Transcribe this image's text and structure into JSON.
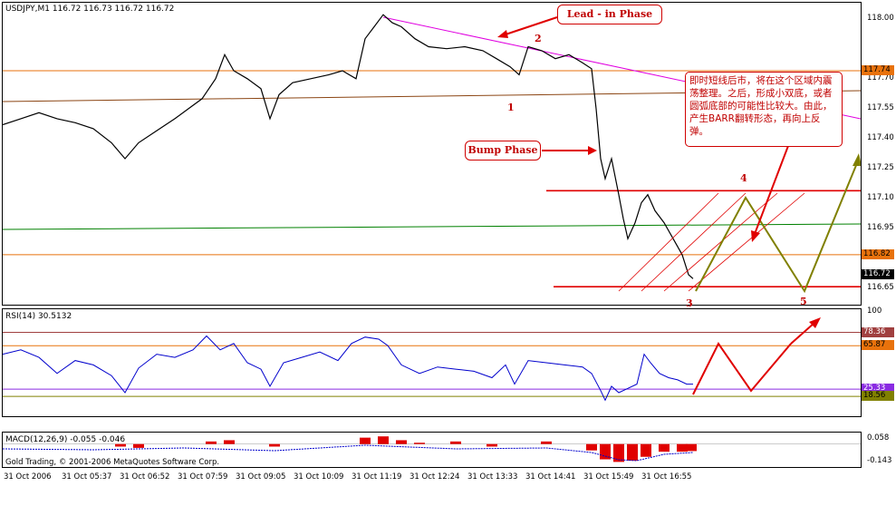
{
  "chart_data": {
    "type": "line",
    "main": {
      "title": "USDJPY,M1  116.72 116.73 116.72 116.72",
      "ylim": [
        116.57,
        118.08
      ],
      "yticks": [
        "118.00",
        "117.70",
        "117.55",
        "117.40",
        "117.25",
        "117.10",
        "116.95",
        "116.65"
      ],
      "ytick_values": [
        118.0,
        117.7,
        117.55,
        117.4,
        117.25,
        117.1,
        116.95,
        116.65
      ],
      "badges": [
        {
          "label": "117.74",
          "value": 117.74,
          "bg": "#e8720c",
          "fg": "#000000"
        },
        {
          "label": "116.82",
          "value": 116.82,
          "bg": "#e8720c",
          "fg": "#000000"
        },
        {
          "label": "116.72",
          "value": 116.72,
          "bg": "#000000",
          "fg": "#ffffff"
        }
      ],
      "price_line": [
        [
          0,
          117.47
        ],
        [
          20,
          117.5
        ],
        [
          40,
          117.53
        ],
        [
          60,
          117.5
        ],
        [
          80,
          117.48
        ],
        [
          100,
          117.45
        ],
        [
          120,
          117.38
        ],
        [
          135,
          117.3
        ],
        [
          150,
          117.38
        ],
        [
          170,
          117.44
        ],
        [
          190,
          117.5
        ],
        [
          205,
          117.55
        ],
        [
          220,
          117.6
        ],
        [
          235,
          117.7
        ],
        [
          245,
          117.82
        ],
        [
          255,
          117.74
        ],
        [
          270,
          117.7
        ],
        [
          285,
          117.65
        ],
        [
          295,
          117.5
        ],
        [
          305,
          117.62
        ],
        [
          320,
          117.68
        ],
        [
          340,
          117.7
        ],
        [
          360,
          117.72
        ],
        [
          375,
          117.74
        ],
        [
          390,
          117.7
        ],
        [
          400,
          117.9
        ],
        [
          410,
          117.96
        ],
        [
          420,
          118.02
        ],
        [
          430,
          117.98
        ],
        [
          440,
          117.96
        ],
        [
          455,
          117.9
        ],
        [
          470,
          117.86
        ],
        [
          490,
          117.85
        ],
        [
          510,
          117.86
        ],
        [
          530,
          117.84
        ],
        [
          545,
          117.8
        ],
        [
          560,
          117.76
        ],
        [
          570,
          117.72
        ],
        [
          580,
          117.86
        ],
        [
          595,
          117.84
        ],
        [
          610,
          117.8
        ],
        [
          625,
          117.82
        ],
        [
          640,
          117.78
        ],
        [
          650,
          117.75
        ],
        [
          655,
          117.55
        ],
        [
          660,
          117.3
        ],
        [
          665,
          117.2
        ],
        [
          672,
          117.3
        ],
        [
          680,
          117.12
        ],
        [
          685,
          117.0
        ],
        [
          690,
          116.9
        ],
        [
          698,
          116.98
        ],
        [
          705,
          117.08
        ],
        [
          712,
          117.12
        ],
        [
          720,
          117.04
        ],
        [
          730,
          116.98
        ],
        [
          740,
          116.9
        ],
        [
          750,
          116.82
        ],
        [
          757,
          116.72
        ],
        [
          762,
          116.7
        ]
      ],
      "hlines": [
        {
          "value": 117.74,
          "color": "#e8720c"
        },
        {
          "value": 116.82,
          "color": "#e8720c"
        },
        {
          "value": 117.14,
          "color": "#e00000"
        },
        {
          "value": 116.66,
          "color": "#e00000"
        }
      ],
      "wave_labels": [
        "1",
        "2",
        "3",
        "4",
        "5"
      ]
    },
    "rsi": {
      "title": "RSI(14) 30.5132",
      "ylim": [
        0,
        100
      ],
      "yticks": [
        "100"
      ],
      "badges": [
        {
          "label": "78.36",
          "value": 78.36,
          "bg": "#a04040",
          "fg": "#ffffff"
        },
        {
          "label": "65.87",
          "value": 65.87,
          "bg": "#e8720c",
          "fg": "#000000"
        },
        {
          "label": "25.33",
          "value": 25.33,
          "bg": "#8a2be2",
          "fg": "#ffffff"
        },
        {
          "label": "18.56",
          "value": 18.56,
          "bg": "#808000",
          "fg": "#000000"
        }
      ],
      "hlines": [
        {
          "value": 78.36,
          "color": "#a04040"
        },
        {
          "value": 65.87,
          "color": "#e8720c"
        },
        {
          "value": 25.33,
          "color": "#8a2be2"
        },
        {
          "value": 18.56,
          "color": "#808000"
        }
      ],
      "line": [
        [
          0,
          58
        ],
        [
          20,
          62
        ],
        [
          40,
          55
        ],
        [
          60,
          40
        ],
        [
          80,
          52
        ],
        [
          100,
          48
        ],
        [
          120,
          38
        ],
        [
          135,
          22
        ],
        [
          150,
          45
        ],
        [
          170,
          58
        ],
        [
          190,
          55
        ],
        [
          210,
          62
        ],
        [
          225,
          75
        ],
        [
          240,
          62
        ],
        [
          255,
          68
        ],
        [
          270,
          50
        ],
        [
          285,
          44
        ],
        [
          295,
          28
        ],
        [
          310,
          50
        ],
        [
          330,
          55
        ],
        [
          350,
          60
        ],
        [
          370,
          52
        ],
        [
          385,
          68
        ],
        [
          400,
          74
        ],
        [
          415,
          72
        ],
        [
          425,
          66
        ],
        [
          440,
          48
        ],
        [
          460,
          40
        ],
        [
          480,
          46
        ],
        [
          500,
          44
        ],
        [
          520,
          42
        ],
        [
          540,
          36
        ],
        [
          555,
          48
        ],
        [
          565,
          30
        ],
        [
          580,
          52
        ],
        [
          600,
          50
        ],
        [
          620,
          48
        ],
        [
          640,
          46
        ],
        [
          650,
          40
        ],
        [
          660,
          24
        ],
        [
          665,
          15
        ],
        [
          672,
          28
        ],
        [
          680,
          22
        ],
        [
          690,
          26
        ],
        [
          700,
          30
        ],
        [
          708,
          58
        ],
        [
          715,
          50
        ],
        [
          725,
          40
        ],
        [
          735,
          36
        ],
        [
          745,
          34
        ],
        [
          755,
          30
        ],
        [
          762,
          30
        ]
      ]
    },
    "macd": {
      "title": "MACD(12,26,9) -0.055 -0.046",
      "yticks": [
        "0.058",
        "-0.143"
      ],
      "ylim": [
        -0.18,
        0.09
      ]
    },
    "x_tick_labels": [
      "31 Oct 2006",
      "31 Oct 05:37",
      "31 Oct 06:52",
      "31 Oct 07:59",
      "31 Oct 09:05",
      "31 Oct 10:09",
      "31 Oct 11:19",
      "31 Oct 12:24",
      "31 Oct 13:33",
      "31 Oct 14:41",
      "31 Oct 15:49",
      "31 Oct 16:55"
    ]
  },
  "annotations": {
    "lead_in": "Lead - in  Phase",
    "bump": "Bump Phase",
    "note": "即时短线后市，将在这个区域内震荡整理。之后，形成小双底，或者圆弧底部的可能性比较大。由此，产生BARR翻转形态，再向上反弹。"
  },
  "copyright": "Gold Trading, © 2001-2006 MetaQuotes Software Corp.",
  "colors": {
    "price": "#000000",
    "trend_magenta": "#e000e0",
    "callout_red": "#c00000",
    "forecast_olive": "#808000",
    "ma_green": "#008000",
    "ma_brown": "#8b4513",
    "rsi_line": "#0000cc",
    "macd_hist": "#e00000"
  }
}
